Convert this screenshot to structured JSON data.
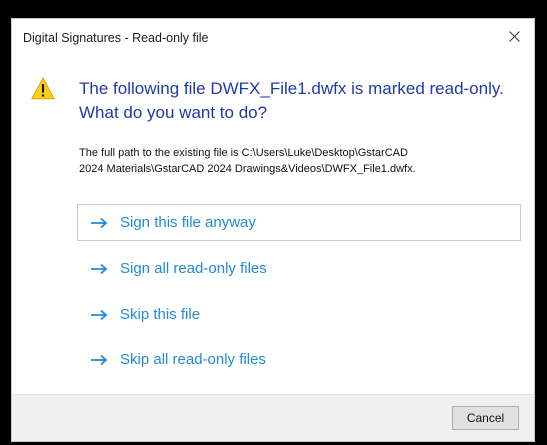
{
  "dialog": {
    "title": "Digital Signatures - Read-only file",
    "close_icon": "close-icon",
    "warning_icon": "warning-icon",
    "main_instruction": "The following file DWFX_File1.dwfx is marked read-only. What do you want to do?",
    "content": "The full path to the existing file is C:\\Users\\Luke\\Desktop\\GstarCAD\n2024 Materials\\GstarCAD 2024 Drawings&Videos\\DWFX_File1.dwfx.",
    "commands": [
      {
        "label": "Sign this file anyway",
        "icon": "arrow-right-icon",
        "focused": true
      },
      {
        "label": "Sign all read-only files",
        "icon": "arrow-right-icon"
      },
      {
        "label": "Skip this file",
        "icon": "arrow-right-icon"
      },
      {
        "label": "Skip all read-only files",
        "icon": "arrow-right-icon"
      }
    ],
    "cancel_label": "Cancel"
  },
  "colors": {
    "instruction": "#1f3aa6",
    "command_link": "#1f8bd6",
    "warning_fill": "#fcd116",
    "footer_bg": "#f0f0f0",
    "outer_background": "#000000"
  }
}
